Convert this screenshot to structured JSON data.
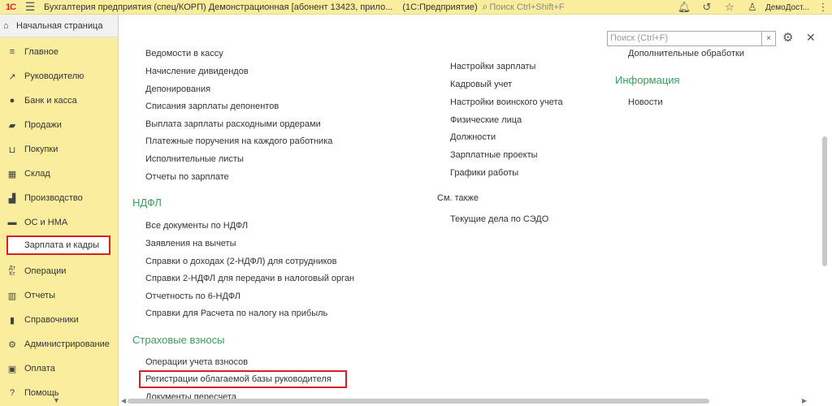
{
  "titlebar": {
    "logo": "1С",
    "title": "Бухгалтерия предприятия (спец/КОРП) Демонстрационная [абонент 13423, прило...",
    "app": "(1С:Предприятие)",
    "search_placeholder": "Поиск Ctrl+Shift+F",
    "user": "ДемоДост..."
  },
  "sidebar": {
    "home": "Начальная страница",
    "items": [
      {
        "label": "Главное",
        "icon": "menu-lines-icon"
      },
      {
        "label": "Руководителю",
        "icon": "trend-icon"
      },
      {
        "label": "Банк и касса",
        "icon": "coin-icon"
      },
      {
        "label": "Продажи",
        "icon": "bag-icon"
      },
      {
        "label": "Покупки",
        "icon": "cart-icon"
      },
      {
        "label": "Склад",
        "icon": "warehouse-icon"
      },
      {
        "label": "Производство",
        "icon": "factory-icon"
      },
      {
        "label": "ОС и НМА",
        "icon": "truck-icon"
      },
      {
        "label": "Зарплата и кадры",
        "icon": "person-icon"
      },
      {
        "label": "Операции",
        "icon": "dt-kt-icon"
      },
      {
        "label": "Отчеты",
        "icon": "bar-chart-icon"
      },
      {
        "label": "Справочники",
        "icon": "books-icon"
      },
      {
        "label": "Администрирование",
        "icon": "gear-icon"
      },
      {
        "label": "Оплата",
        "icon": "payment-icon"
      },
      {
        "label": "Помощь",
        "icon": "question-icon"
      }
    ]
  },
  "content": {
    "search_placeholder": "Поиск (Ctrl+F)",
    "col1": {
      "links_top": [
        "Ведомости в кассу",
        "Начисление дивидендов",
        "Депонирования",
        "Списания зарплаты депонентов",
        "Выплата зарплаты расходными ордерами",
        "Платежные поручения на каждого работника",
        "Исполнительные листы",
        "Отчеты по зарплате"
      ],
      "ndfl_header": "НДФЛ",
      "ndfl_links": [
        "Все документы по НДФЛ",
        "Заявления на вычеты",
        "Справки о доходах (2-НДФЛ) для сотрудников",
        "Справки 2-НДФЛ для передачи в налоговый орган",
        "Отчетность по 6-НДФЛ",
        "Справки для Расчета по налогу на прибыль"
      ],
      "ins_header": "Страховые взносы",
      "ins_links": [
        "Операции учета взносов",
        "Регистрации облагаемой базы руководителя",
        "Документы пересчета"
      ]
    },
    "col2": {
      "links": [
        "Настройки зарплаты",
        "Кадровый учет",
        "Настройки воинского учета",
        "Физические лица",
        "Должности",
        "Зарплатные проекты",
        "Графики работы"
      ],
      "see_also": "См. также",
      "see_also_links": [
        "Текущие дела по СЭДО"
      ]
    },
    "col3": {
      "links": [
        "Дополнительные обработки"
      ],
      "info_header": "Информация",
      "info_links": [
        "Новости"
      ]
    }
  }
}
